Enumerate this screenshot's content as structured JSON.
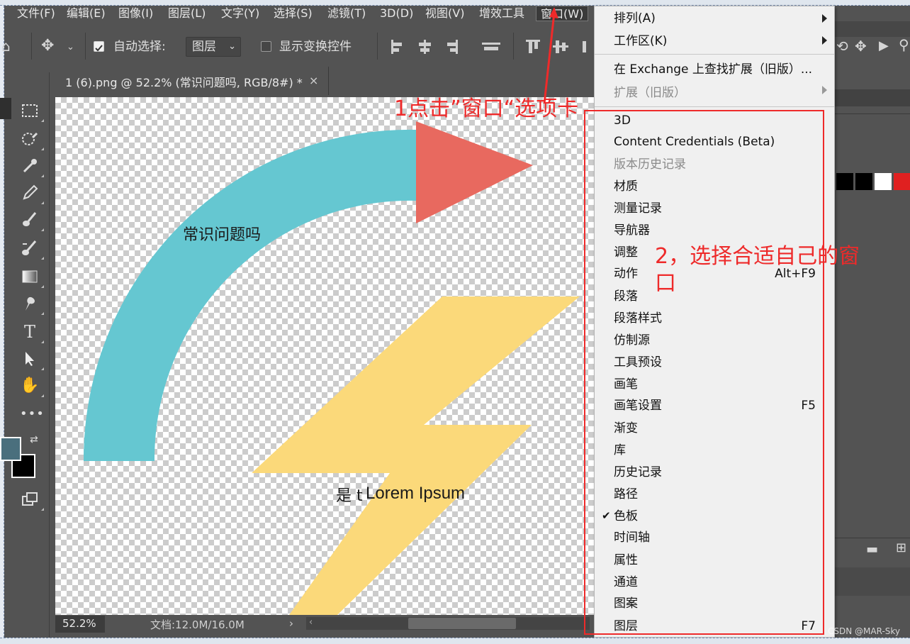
{
  "menubar": {
    "items": [
      "文件(F)",
      "编辑(E)",
      "图像(I)",
      "图层(L)",
      "文字(Y)",
      "选择(S)",
      "滤镜(T)",
      "3D(D)",
      "视图(V)",
      "增效工具",
      "窗口(W)"
    ]
  },
  "options_bar": {
    "auto_select_label": "自动选择:",
    "auto_select_checked": true,
    "layer_select_value": "图层",
    "show_transform_label": "显示变换控件",
    "show_transform_checked": false
  },
  "document": {
    "tab_title": "1 (6).png @ 52.2% (常识问题吗, RGB/8#) *",
    "close_glyph": "×"
  },
  "canvas": {
    "arc_text": "常识问题吗",
    "bolt_text_prefix": "是 t",
    "bolt_text": "Lorem Ipsum",
    "colors": {
      "arc": "#65c7d1",
      "arrow": "#e8695f",
      "bolt": "#fbd97a"
    }
  },
  "status": {
    "zoom": "52.2%",
    "doc_size": "文档:12.0M/16.0M"
  },
  "window_menu": {
    "top_items": [
      {
        "label": "排列(A)",
        "submenu": true
      },
      {
        "label": "工作区(K)",
        "submenu": true
      }
    ],
    "ext_items": [
      {
        "label": "在 Exchange 上查找扩展（旧版）...",
        "disabled": false
      },
      {
        "label": "扩展（旧版）",
        "disabled": true,
        "submenu": true
      }
    ],
    "panel_items": [
      {
        "label": "3D"
      },
      {
        "label": "Content Credentials (Beta)"
      },
      {
        "label": "版本历史记录",
        "disabled": true
      },
      {
        "label": "材质"
      },
      {
        "label": "测量记录"
      },
      {
        "label": "导航器"
      },
      {
        "label": "调整"
      },
      {
        "label": "动作",
        "shortcut": "Alt+F9"
      },
      {
        "label": "段落"
      },
      {
        "label": "段落样式"
      },
      {
        "label": "仿制源"
      },
      {
        "label": "工具预设"
      },
      {
        "label": "画笔"
      },
      {
        "label": "画笔设置",
        "shortcut": "F5"
      },
      {
        "label": "渐变"
      },
      {
        "label": "库"
      },
      {
        "label": "历史记录"
      },
      {
        "label": "路径"
      },
      {
        "label": "色板",
        "checked": true
      },
      {
        "label": "时间轴"
      },
      {
        "label": "属性"
      },
      {
        "label": "通道"
      },
      {
        "label": "图案"
      },
      {
        "label": "图层",
        "shortcut": "F7"
      }
    ]
  },
  "annotations": {
    "step1": "1点击”窗口“选项卡",
    "step2": "2，选择合适自己的窗口",
    "color": "#ee2a2a"
  },
  "colors": {
    "foreground": "#4a6f7d",
    "background": "#000000"
  },
  "watermark": "CSDN @MAR-Sky",
  "icons": [
    "move-icon",
    "align-icons",
    "marquee-icon",
    "lasso-icon",
    "eyedropper-icon",
    "pencil-icon",
    "brush-icon",
    "eraser-icon",
    "gradient-icon",
    "smudge-icon",
    "type-icon",
    "path-select-icon",
    "hand-icon",
    "more-icon",
    "screen-mode-icon"
  ]
}
